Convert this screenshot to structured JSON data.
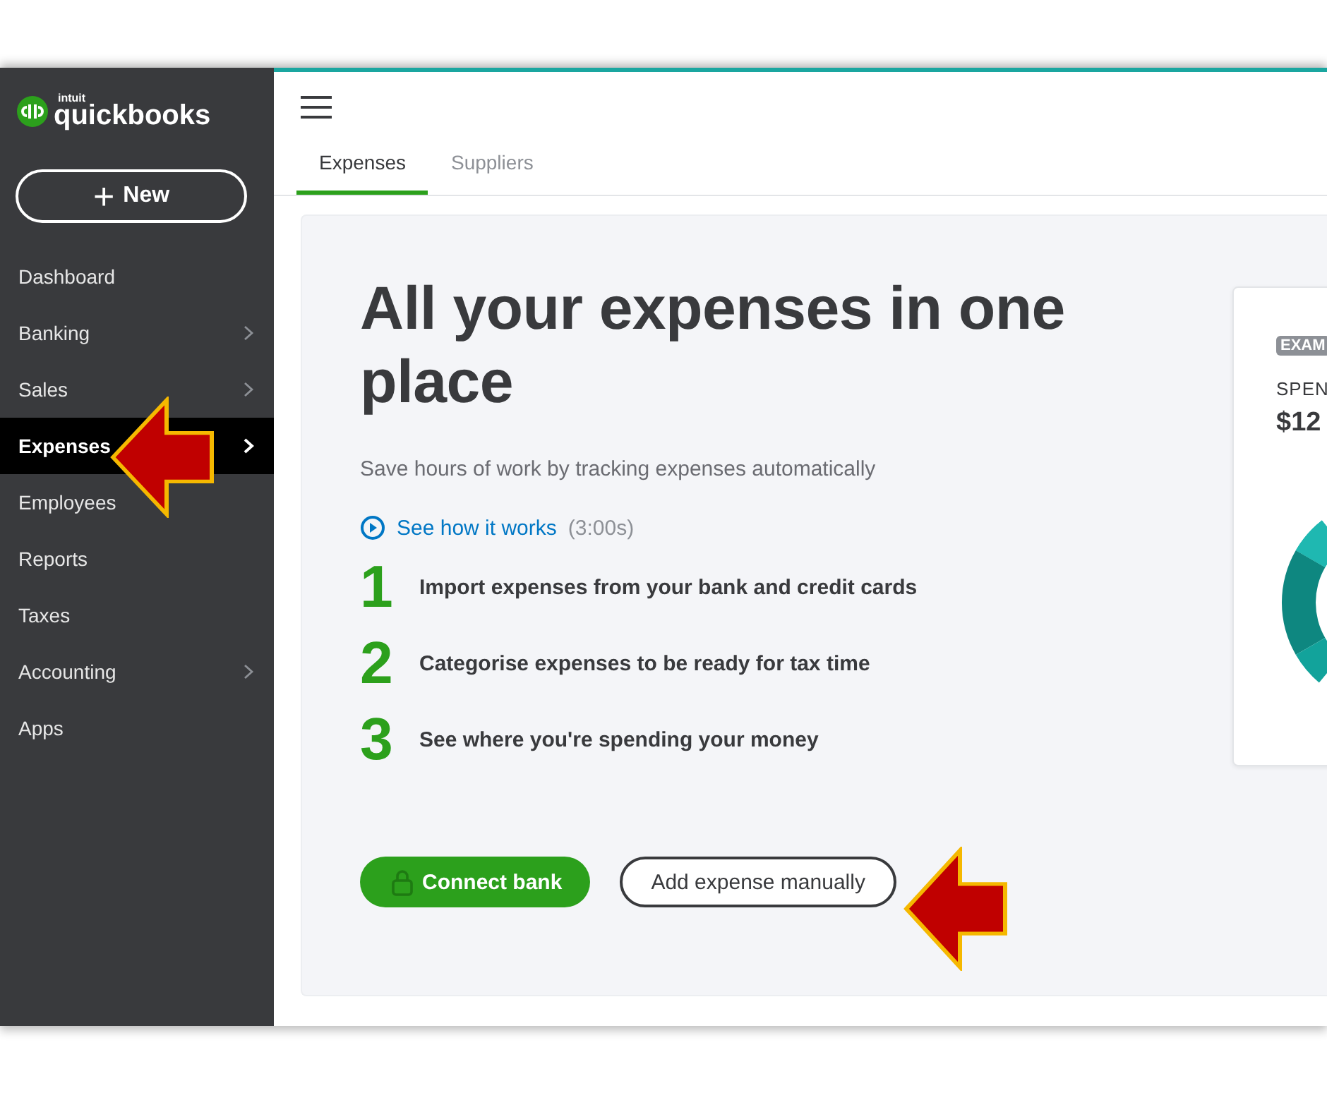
{
  "logo": {
    "maker": "intuit",
    "product": "quickbooks"
  },
  "new_button": {
    "icon": "+",
    "label": "New"
  },
  "sidebar": {
    "items": [
      {
        "label": "Dashboard",
        "selected": false,
        "has_submenu": false
      },
      {
        "label": "Banking",
        "selected": false,
        "has_submenu": true
      },
      {
        "label": "Sales",
        "selected": false,
        "has_submenu": true
      },
      {
        "label": "Expenses",
        "selected": true,
        "has_submenu": true
      },
      {
        "label": "Employees",
        "selected": false,
        "has_submenu": false
      },
      {
        "label": "Reports",
        "selected": false,
        "has_submenu": false
      },
      {
        "label": "Taxes",
        "selected": false,
        "has_submenu": false
      },
      {
        "label": "Accounting",
        "selected": false,
        "has_submenu": true
      },
      {
        "label": "Apps",
        "selected": false,
        "has_submenu": false
      }
    ]
  },
  "tabs": [
    {
      "label": "Expenses",
      "selected": true
    },
    {
      "label": "Suppliers",
      "selected": false
    }
  ],
  "intro": {
    "title": "All your expenses in one place",
    "subtitle": "Save hours of work by tracking expenses automatically",
    "video_link": "See how it works",
    "video_length": "(3:00s)",
    "steps": [
      {
        "number": "1",
        "text": "Import expenses from your bank and credit cards"
      },
      {
        "number": "2",
        "text": "Categorise expenses to be ready for tax time"
      },
      {
        "number": "3",
        "text": "See where you're spending your money"
      }
    ],
    "primary_button": "Connect bank",
    "secondary_button": "Add expense manually"
  },
  "example_card": {
    "badge": "EXAM",
    "label": "SPEN",
    "amount": "$12"
  }
}
